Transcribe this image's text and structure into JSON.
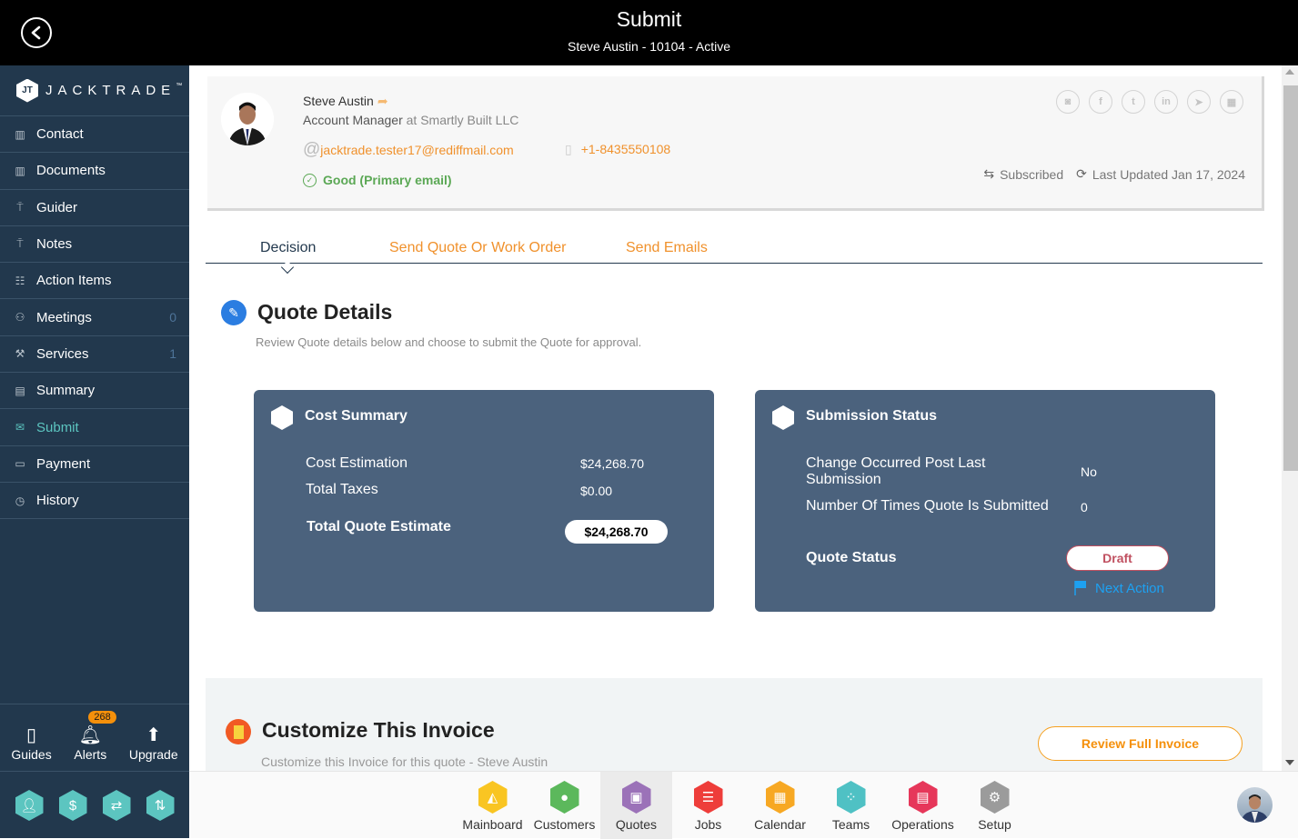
{
  "header": {
    "title": "Submit",
    "subtitle": "Steve Austin - 10104 - Active",
    "back_icon": "back-arrow-circle-icon"
  },
  "sidebar": {
    "logo_text": "JACKTRADE",
    "logo_tm": "™",
    "items": [
      {
        "label": "Contact",
        "icon": "address-book-icon",
        "count": ""
      },
      {
        "label": "Documents",
        "icon": "address-book-icon",
        "count": ""
      },
      {
        "label": "Guider",
        "icon": "signpost-icon",
        "count": ""
      },
      {
        "label": "Notes",
        "icon": "signpost-icon",
        "count": ""
      },
      {
        "label": "Action Items",
        "icon": "clipboard-list-icon",
        "count": ""
      },
      {
        "label": "Meetings",
        "icon": "people-meeting-icon",
        "count": "0"
      },
      {
        "label": "Services",
        "icon": "worker-icon",
        "count": "1"
      },
      {
        "label": "Summary",
        "icon": "document-pages-icon",
        "count": ""
      },
      {
        "label": "Submit",
        "icon": "send-envelope-icon",
        "count": "",
        "active": true
      },
      {
        "label": "Payment",
        "icon": "credit-card-icon",
        "count": ""
      },
      {
        "label": "History",
        "icon": "history-list-icon",
        "count": ""
      }
    ],
    "tools": [
      {
        "label": "Guides",
        "icon": "book-icon"
      },
      {
        "label": "Alerts",
        "icon": "bell-icon",
        "badge": "268"
      },
      {
        "label": "Upgrade",
        "icon": "arrow-up-icon"
      }
    ],
    "quick_hexes": [
      "user-icon",
      "dollar-icon",
      "money-transfer-icon",
      "workflow-icon"
    ]
  },
  "profile": {
    "name": "Steve Austin",
    "role": "Account Manager",
    "at_text": "at",
    "company": "Smartly Built LLC",
    "email": "jacktrade.tester17@rediffmail.com",
    "phone": "+1-8435550108",
    "email_status": "Good (Primary email)",
    "subscription": "Subscribed",
    "last_updated": "Last Updated Jan 17, 2024",
    "socials": [
      "instagram-icon",
      "facebook-icon",
      "twitter-icon",
      "linkedin-icon",
      "telegram-icon",
      "apps-icon"
    ]
  },
  "tabs": [
    {
      "label": "Decision",
      "active": true
    },
    {
      "label": "Send Quote Or Work Order"
    },
    {
      "label": "Send Emails"
    }
  ],
  "quote_details": {
    "title": "Quote Details",
    "subtitle": "Review Quote details below and choose to submit the Quote for approval."
  },
  "cost_summary": {
    "title": "Cost Summary",
    "rows": [
      {
        "label": "Cost Estimation",
        "value": "$24,268.70"
      },
      {
        "label": "Total Taxes",
        "value": "$0.00"
      }
    ],
    "total_label": "Total Quote Estimate",
    "total_value": "$24,268.70"
  },
  "submission_status": {
    "title": "Submission Status",
    "rows": [
      {
        "label": "Change Occurred Post Last Submission",
        "value": "No"
      },
      {
        "label": "Number Of Times Quote Is Submitted",
        "value": "0"
      }
    ],
    "status_label": "Quote Status",
    "status_value": "Draft",
    "next_action": "Next Action"
  },
  "invoice": {
    "title": "Customize This Invoice",
    "subtitle": "Customize this Invoice for this quote - Steve Austin",
    "review_button": "Review Full Invoice"
  },
  "bottom_nav": [
    {
      "label": "Mainboard",
      "icon": "mainboard-icon",
      "color": "#f9c522"
    },
    {
      "label": "Customers",
      "icon": "customer-icon",
      "color": "#5cb85c"
    },
    {
      "label": "Quotes",
      "icon": "quotes-icon",
      "color": "#9b72b8",
      "active": true
    },
    {
      "label": "Jobs",
      "icon": "jobs-list-icon",
      "color": "#ee3d3a"
    },
    {
      "label": "Calendar",
      "icon": "calendar-icon",
      "color": "#f7a823"
    },
    {
      "label": "Teams",
      "icon": "teams-icon",
      "color": "#4fc1c4"
    },
    {
      "label": "Operations",
      "icon": "briefcase-icon",
      "color": "#e6375a"
    },
    {
      "label": "Setup",
      "icon": "gear-icon",
      "color": "#9b9b9b"
    }
  ],
  "colors": {
    "sidebar_bg": "#22384d",
    "accent_orange": "#f0912c",
    "accent_teal": "#5cc5c0",
    "card_bg": "#4b627d",
    "draft_red": "#c05060",
    "link_blue": "#1da1f2"
  }
}
